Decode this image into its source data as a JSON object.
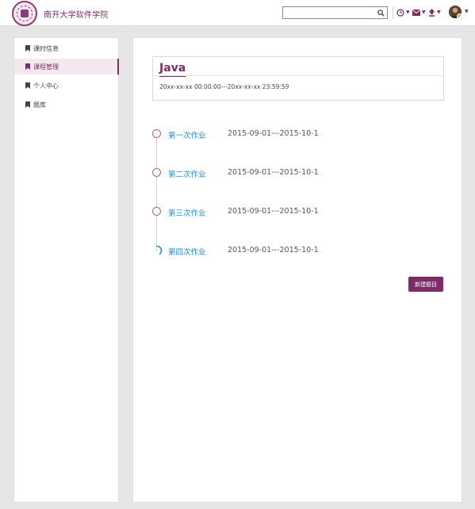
{
  "header": {
    "brand": "南开大学软件学院",
    "search": {
      "value": "",
      "placeholder": ""
    },
    "icons": [
      "clock-icon",
      "mail-icon",
      "upload-icon",
      "avatar"
    ]
  },
  "sidebar": {
    "items": [
      {
        "label": "课时信息",
        "active": false
      },
      {
        "label": "课程管理",
        "active": true
      },
      {
        "label": "个人中心",
        "active": false
      },
      {
        "label": "题库",
        "active": false
      }
    ]
  },
  "course": {
    "title": "Java",
    "range": "20xx-xx-xx 00:00:00---20xx-xx-xx 23:59:59"
  },
  "assignments": [
    {
      "name": "第一次作业",
      "range": "2015-09-01---2015-10-1",
      "status": "pending"
    },
    {
      "name": "第二次作业",
      "range": "2015-09-01---2015-10-1",
      "status": "pending"
    },
    {
      "name": "第三次作业",
      "range": "2015-09-01---2015-10-1",
      "status": "pending"
    },
    {
      "name": "第四次作业",
      "range": "2015-09-01---2015-10-1",
      "status": "in-progress"
    }
  ],
  "actions": {
    "new_item": "新建题目"
  },
  "colors": {
    "accent": "#7b2d66",
    "link": "#1e8fd6",
    "background": "#e6e6e6"
  }
}
